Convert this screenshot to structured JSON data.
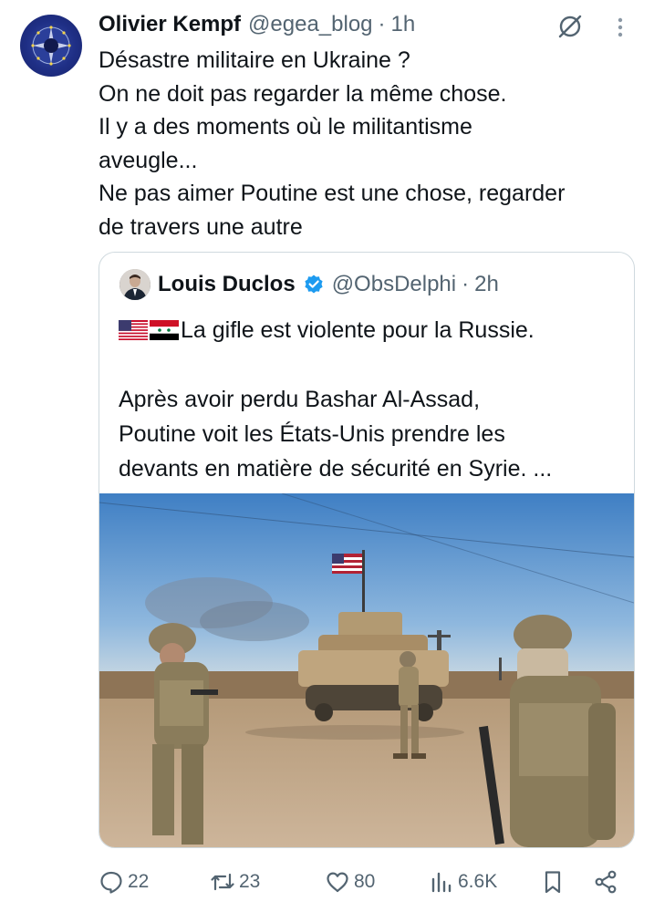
{
  "tweet": {
    "author_name": "Olivier Kempf",
    "handle": "@egea_blog",
    "separator": "·",
    "time": "1h",
    "lines": [
      "Désastre militaire en Ukraine ?",
      "On ne doit pas regarder la même chose.",
      "Il y a des moments où le militantisme",
      "aveugle...",
      "Ne pas aimer Poutine est une chose, regarder",
      "de travers une autre"
    ]
  },
  "quote": {
    "author_name": "Louis Duclos",
    "handle": "@ObsDelphi",
    "separator": "·",
    "time": "2h",
    "first_line": "La gifle est violente pour la Russie.",
    "lines": [
      "Après avoir perdu Bashar Al-Assad,",
      "Poutine voit les États-Unis prendre les",
      "devants en matière de sécurité en Syrie. ..."
    ],
    "flags": [
      "us-flag-icon",
      "syria-flag-icon"
    ]
  },
  "actions": {
    "replies": "22",
    "reposts": "23",
    "likes": "80",
    "views": "6.6K"
  },
  "icons": [
    "grok-icon",
    "more-icon",
    "verified-badge-icon",
    "reply-icon",
    "repost-icon",
    "like-icon",
    "views-icon",
    "bookmark-icon",
    "share-icon"
  ],
  "colors": {
    "text": "#0f1419",
    "secondary": "#536471",
    "border": "#cfd9de",
    "verified": "#1d9bf0"
  }
}
